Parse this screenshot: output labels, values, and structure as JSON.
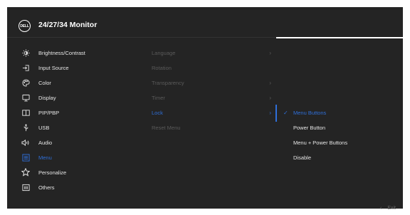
{
  "header": {
    "logo_text": "DELL",
    "title": "24/27/34 Monitor"
  },
  "main_menu": [
    {
      "label": "Brightness/Contrast",
      "icon": "brightness-icon"
    },
    {
      "label": "Input Source",
      "icon": "input-source-icon"
    },
    {
      "label": "Color",
      "icon": "color-palette-icon"
    },
    {
      "label": "Display",
      "icon": "display-icon"
    },
    {
      "label": "PIP/PBP",
      "icon": "pip-pbp-icon"
    },
    {
      "label": "USB",
      "icon": "usb-icon"
    },
    {
      "label": "Audio",
      "icon": "audio-icon"
    },
    {
      "label": "Menu",
      "icon": "menu-icon",
      "active": true
    },
    {
      "label": "Personalize",
      "icon": "personalize-star-icon"
    },
    {
      "label": "Others",
      "icon": "others-icon"
    }
  ],
  "submenu": [
    {
      "label": "Language",
      "chevron": "›"
    },
    {
      "label": "Rotation",
      "chevron": ""
    },
    {
      "label": "Transparency",
      "chevron": "›"
    },
    {
      "label": "Timer",
      "chevron": "›"
    },
    {
      "label": "Lock",
      "chevron": "›",
      "active": true
    },
    {
      "label": "Reset Menu",
      "chevron": ""
    }
  ],
  "lock_options": [
    {
      "label": "Menu Buttons",
      "selected": true
    },
    {
      "label": "Power Button"
    },
    {
      "label": "Menu + Power Buttons"
    },
    {
      "label": "Disable"
    }
  ],
  "footer": {
    "exit_arrow": "‹",
    "exit_label": "Exit"
  },
  "colors": {
    "background": "#242424",
    "accent": "#2f6fd9",
    "text": "#e6e6e6",
    "disabled_text": "#5a5a5a"
  }
}
